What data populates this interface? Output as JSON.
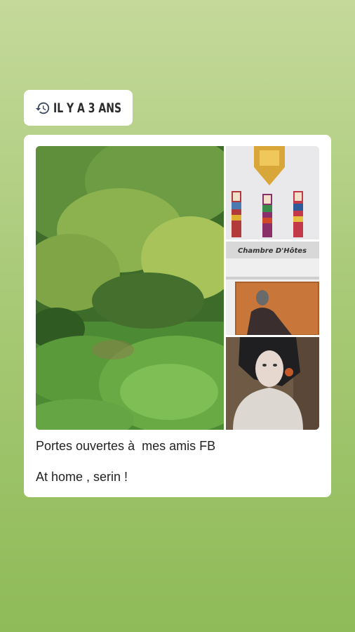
{
  "memory_badge": {
    "icon": "history-icon",
    "label": "IL Y A 3 ANS"
  },
  "post": {
    "photos": [
      {
        "name": "garden-bamboo-photo"
      },
      {
        "name": "wall-dolls-photo"
      },
      {
        "name": "chambre-hotes-sign-photo",
        "sign_text": "Chambre D'Hôtes"
      },
      {
        "name": "mannequin-bust-photo"
      }
    ],
    "caption_line1": "Portes ouvertes à  mes amis FB",
    "caption_line2": "At home , serin !"
  },
  "colors": {
    "background_top": "#c4d99a",
    "background_bottom": "#8fbb58",
    "card": "#ffffff",
    "text": "#222222"
  }
}
